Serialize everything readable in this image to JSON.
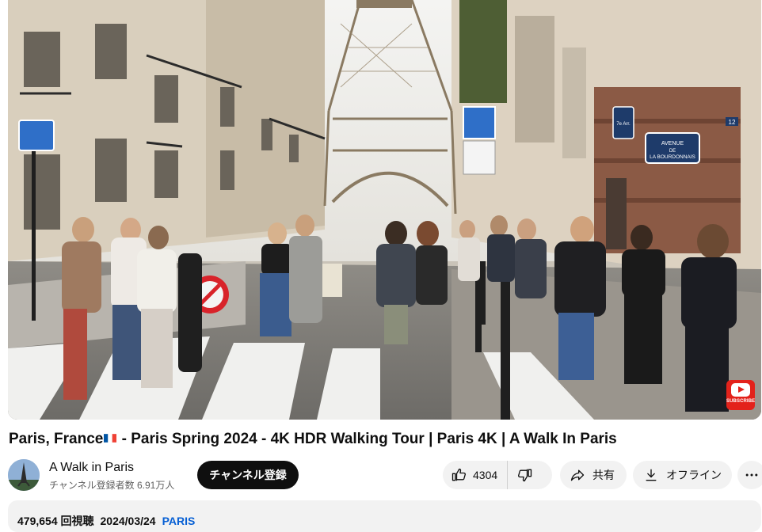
{
  "video": {
    "watermark_label": "SUBSCRIBE",
    "scene_signs": {
      "avenue_line1": "AVENUE",
      "avenue_line2": "DE",
      "avenue_line3": "LA BOURDONNAIS",
      "arrondissement_sign": "7e Arr.",
      "number_plate": "12"
    }
  },
  "title": {
    "before_flag": "Paris, France",
    "after_flag": " - Paris Spring 2024 - 4K HDR Walking Tour | Paris 4K | A Walk In Paris"
  },
  "channel": {
    "name": "A Walk in Paris",
    "subscribers": "チャンネル登録者数 6.91万人",
    "subscribe_label": "チャンネル登録"
  },
  "actions": {
    "like_count": "4304",
    "share_label": "共有",
    "offline_label": "オフライン"
  },
  "description": {
    "views": "479,654 回視聴",
    "date": "2024/03/24",
    "hashtag": "PARIS"
  },
  "icons": {
    "like": "thumbs-up-icon",
    "dislike": "thumbs-down-icon",
    "share": "share-arrow-icon",
    "offline": "download-icon",
    "more": "more-dots-icon"
  },
  "colors": {
    "subscribe_bg": "#0f0f0f",
    "pill_bg": "#f2f2f2",
    "hashtag": "#065fd4",
    "youtube_red": "#e3221b"
  }
}
